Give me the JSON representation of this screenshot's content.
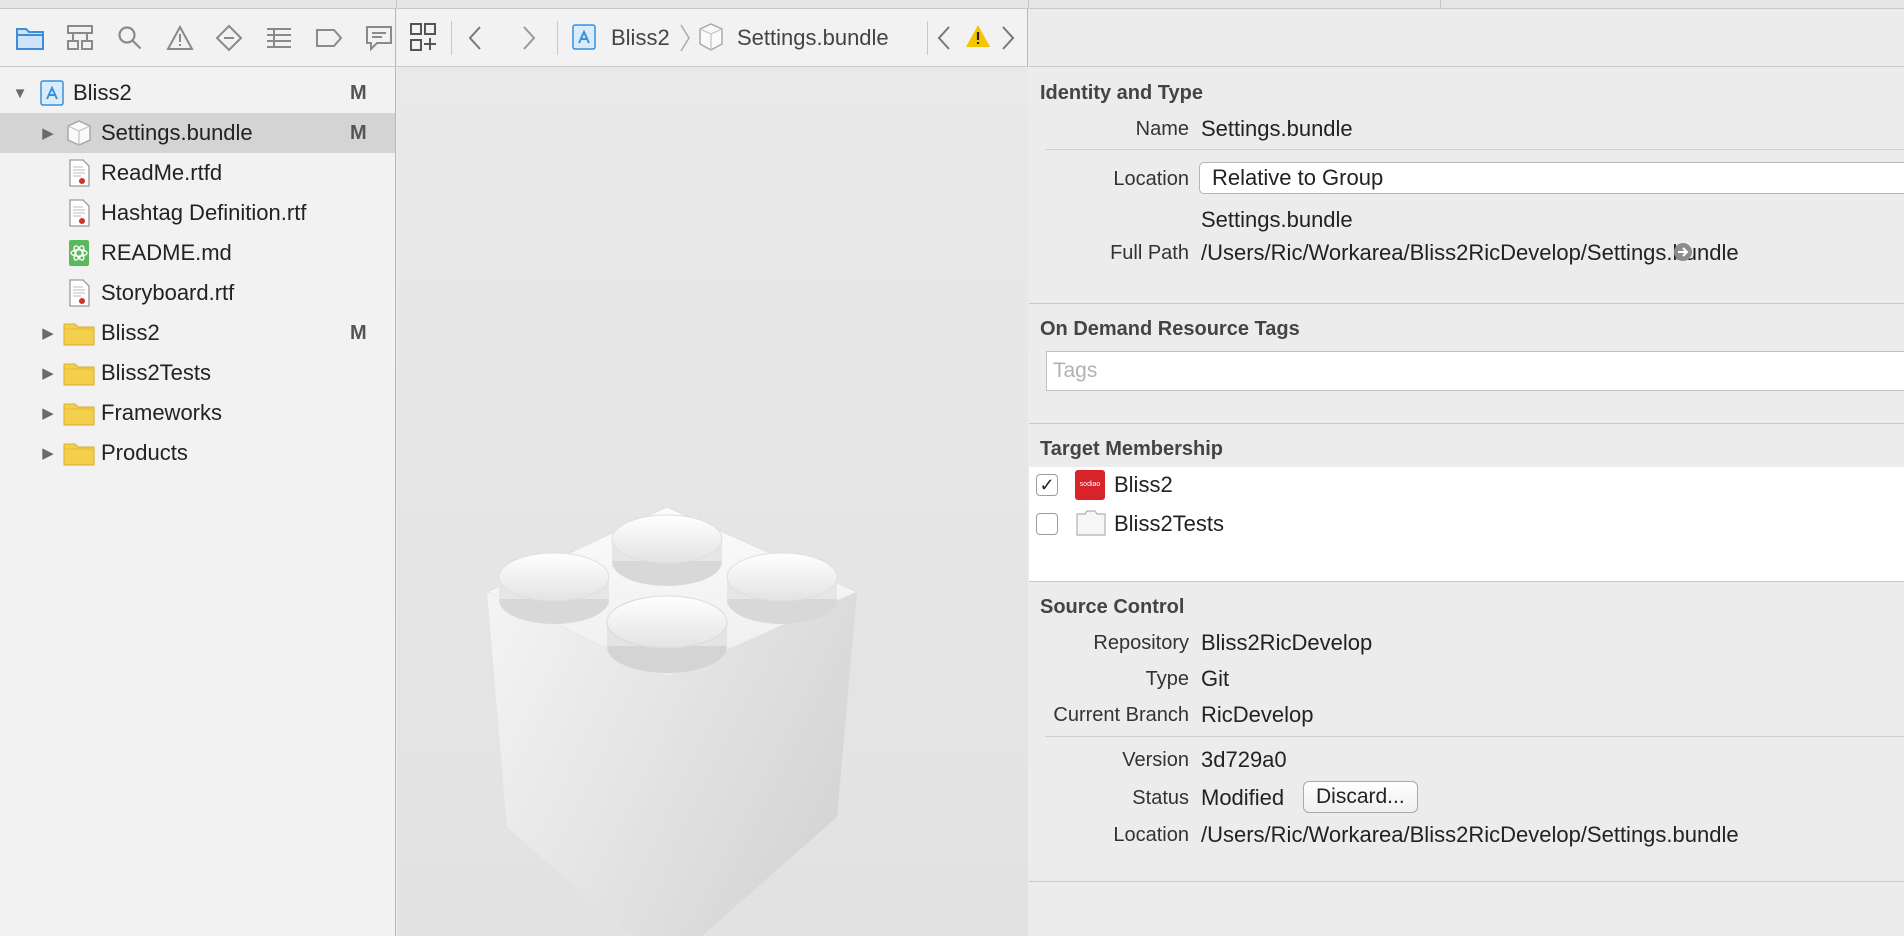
{
  "navigator": {
    "project": {
      "name": "Bliss2",
      "badge": "M"
    },
    "items": [
      {
        "label": "Settings.bundle",
        "badge": "M",
        "type": "bundle",
        "selected": true,
        "expandable": true
      },
      {
        "label": "ReadMe.rtfd",
        "badge": "",
        "type": "rtf",
        "expandable": false
      },
      {
        "label": "Hashtag Definition.rtf",
        "badge": "",
        "type": "rtf",
        "expandable": false
      },
      {
        "label": "README.md",
        "badge": "",
        "type": "md",
        "expandable": false
      },
      {
        "label": "Storyboard.rtf",
        "badge": "",
        "type": "rtf",
        "expandable": false
      },
      {
        "label": "Bliss2",
        "badge": "M",
        "type": "folder",
        "expandable": true
      },
      {
        "label": "Bliss2Tests",
        "badge": "",
        "type": "folder",
        "expandable": true
      },
      {
        "label": "Frameworks",
        "badge": "",
        "type": "folder",
        "expandable": true
      },
      {
        "label": "Products",
        "badge": "",
        "type": "folder",
        "expandable": true
      }
    ]
  },
  "jumpbar": {
    "crumbs": [
      "Bliss2",
      "Settings.bundle"
    ]
  },
  "inspector": {
    "identity": {
      "title": "Identity and Type",
      "name_label": "Name",
      "name_value": "Settings.bundle",
      "location_label": "Location",
      "location_value": "Relative to Group",
      "location_file": "Settings.bundle",
      "fullpath_label": "Full Path",
      "fullpath_value": "/Users/Ric/Workarea/Bliss2RicDevelop/Settings.bundle"
    },
    "tags": {
      "title": "On Demand Resource Tags",
      "placeholder": "Tags"
    },
    "membership": {
      "title": "Target Membership",
      "targets": [
        {
          "name": "Bliss2",
          "checked": true,
          "icon_text": "sodiao"
        },
        {
          "name": "Bliss2Tests",
          "checked": false,
          "icon_text": ""
        }
      ]
    },
    "source_control": {
      "title": "Source Control",
      "repository_label": "Repository",
      "repository_value": "Bliss2RicDevelop",
      "type_label": "Type",
      "type_value": "Git",
      "branch_label": "Current Branch",
      "branch_value": "RicDevelop",
      "version_label": "Version",
      "version_value": "3d729a0",
      "status_label": "Status",
      "status_value": "Modified",
      "discard_label": "Discard...",
      "location_label": "Location",
      "location_value": "/Users/Ric/Workarea/Bliss2RicDevelop/Settings.bundle"
    }
  },
  "colors": {
    "warning": "#f5c400",
    "folder": "#f4cf4c",
    "accent": "#3b8fd9",
    "target_red": "#d8232a"
  }
}
